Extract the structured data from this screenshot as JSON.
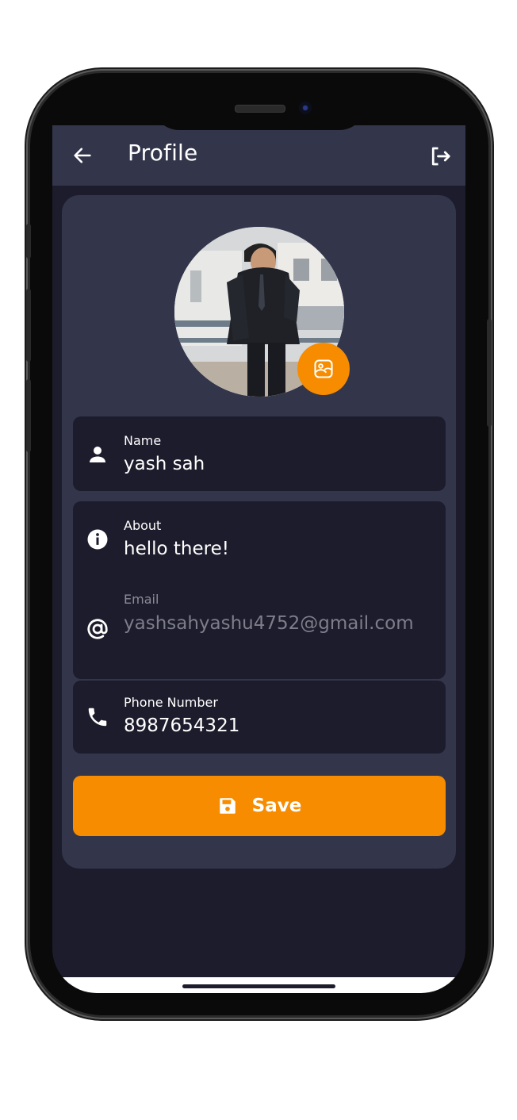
{
  "app_bar": {
    "title": "Profile",
    "back_icon": "arrow-left-icon",
    "logout_icon": "logout-icon"
  },
  "profile": {
    "avatar_alt": "profile photo",
    "edit_photo_icon": "image-edit-icon"
  },
  "fields": {
    "name": {
      "label": "Name",
      "value": "yash sah",
      "icon": "person-icon"
    },
    "about": {
      "label": "About",
      "value": "hello there!",
      "icon": "info-icon"
    },
    "email": {
      "label": "Email",
      "value": "yashsahyashu4752@gmail.com",
      "icon": "at-icon",
      "disabled": true
    },
    "phone": {
      "label": "Phone Number",
      "value": "8987654321",
      "icon": "phone-icon"
    }
  },
  "save_button": {
    "label": "Save",
    "icon": "save-icon"
  },
  "colors": {
    "accent": "#f78c00",
    "surface": "#33364b",
    "background": "#1d1c2c"
  }
}
